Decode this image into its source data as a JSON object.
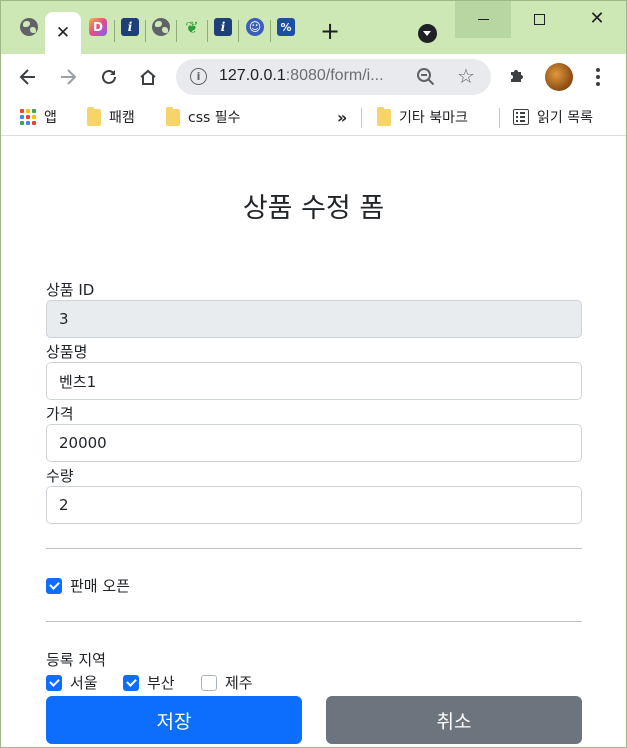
{
  "browser": {
    "active_tab_close": "✕",
    "new_tab": "+",
    "favicons": {
      "tab1": "globe-icon",
      "tab3": "D",
      "tab4": "i",
      "tab5": "globe-icon",
      "tab6": "sprout-icon",
      "tab7": "i",
      "tab8": "face-icon",
      "tab9": "%"
    },
    "url_host": "127.0.0.1",
    "url_rest": ":8080/form/i...",
    "window_close": "✕"
  },
  "bookmarks": {
    "apps": "앱",
    "items": [
      "패캠",
      "css 필수"
    ],
    "overflow": "»",
    "other": "기타 북마크",
    "reading_list": "읽기 목록"
  },
  "form": {
    "title": "상품 수정 폼",
    "id_label": "상품 ID",
    "id_value": "3",
    "name_label": "상품명",
    "name_value": "벤츠1",
    "price_label": "가격",
    "price_value": "20000",
    "quantity_label": "수량",
    "quantity_value": "2",
    "open_label": "판매 오픈",
    "open_checked": true,
    "regions_label": "등록 지역",
    "regions": [
      {
        "label": "서울",
        "checked": true
      },
      {
        "label": "부산",
        "checked": true
      },
      {
        "label": "제주",
        "checked": false
      }
    ],
    "save_label": "저장",
    "cancel_label": "취소"
  },
  "colors": {
    "tab_strip": "#cde8b5",
    "primary": "#0d6efd",
    "secondary": "#6c757d",
    "readonly_bg": "#e9ecef"
  }
}
